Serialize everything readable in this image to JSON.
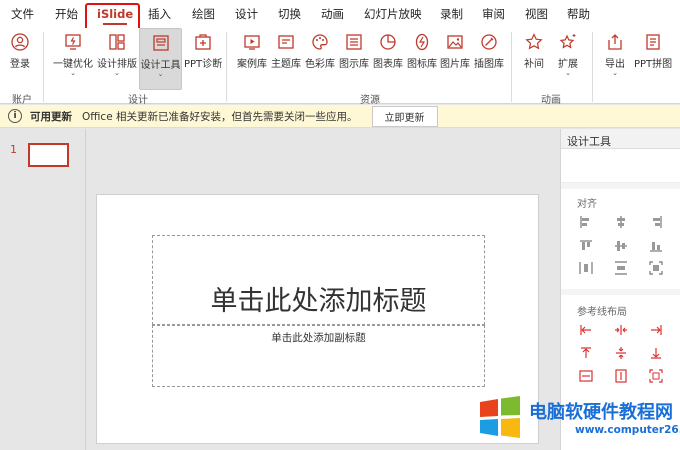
{
  "tabs": [
    "文件",
    "开始",
    "iSlide",
    "插入",
    "绘图",
    "设计",
    "切换",
    "动画",
    "幻灯片放映",
    "录制",
    "审阅",
    "视图",
    "帮助"
  ],
  "ribbon": {
    "login": "登录",
    "optimize": "一键优化",
    "layout": "设计排版",
    "design_tools": "设计工具",
    "ppt_diag": "PPT诊断",
    "cases": "案例库",
    "themes": "主题库",
    "colors": "色彩库",
    "diagrams": "图示库",
    "charts": "图表库",
    "icons": "图标库",
    "pictures": "图片库",
    "illustrations": "插图库",
    "tween": "补间",
    "extend": "扩展",
    "export": "导出",
    "ppt_puzzle": "PPT拼图",
    "groups": {
      "account": "账户",
      "design": "设计",
      "resources": "资源",
      "animation": "动画"
    }
  },
  "notice": {
    "title": "可用更新",
    "message": "Office 相关更新已准备好安装，但首先需要关闭一些应用。",
    "button": "立即更新"
  },
  "thumbnail": {
    "number": "1"
  },
  "slide": {
    "title_placeholder": "单击此处添加标题",
    "subtitle_placeholder": "单击此处添加副标题"
  },
  "panel": {
    "title": "设计工具",
    "align": "对齐",
    "guide_layout": "参考线布局"
  },
  "watermark": {
    "name": "电脑软硬件教程网",
    "url": "www.computer26.com"
  },
  "colors": {
    "accent": "#c0392b",
    "notice_bg": "#fff8d6",
    "watermark": "#1a6fd6"
  }
}
